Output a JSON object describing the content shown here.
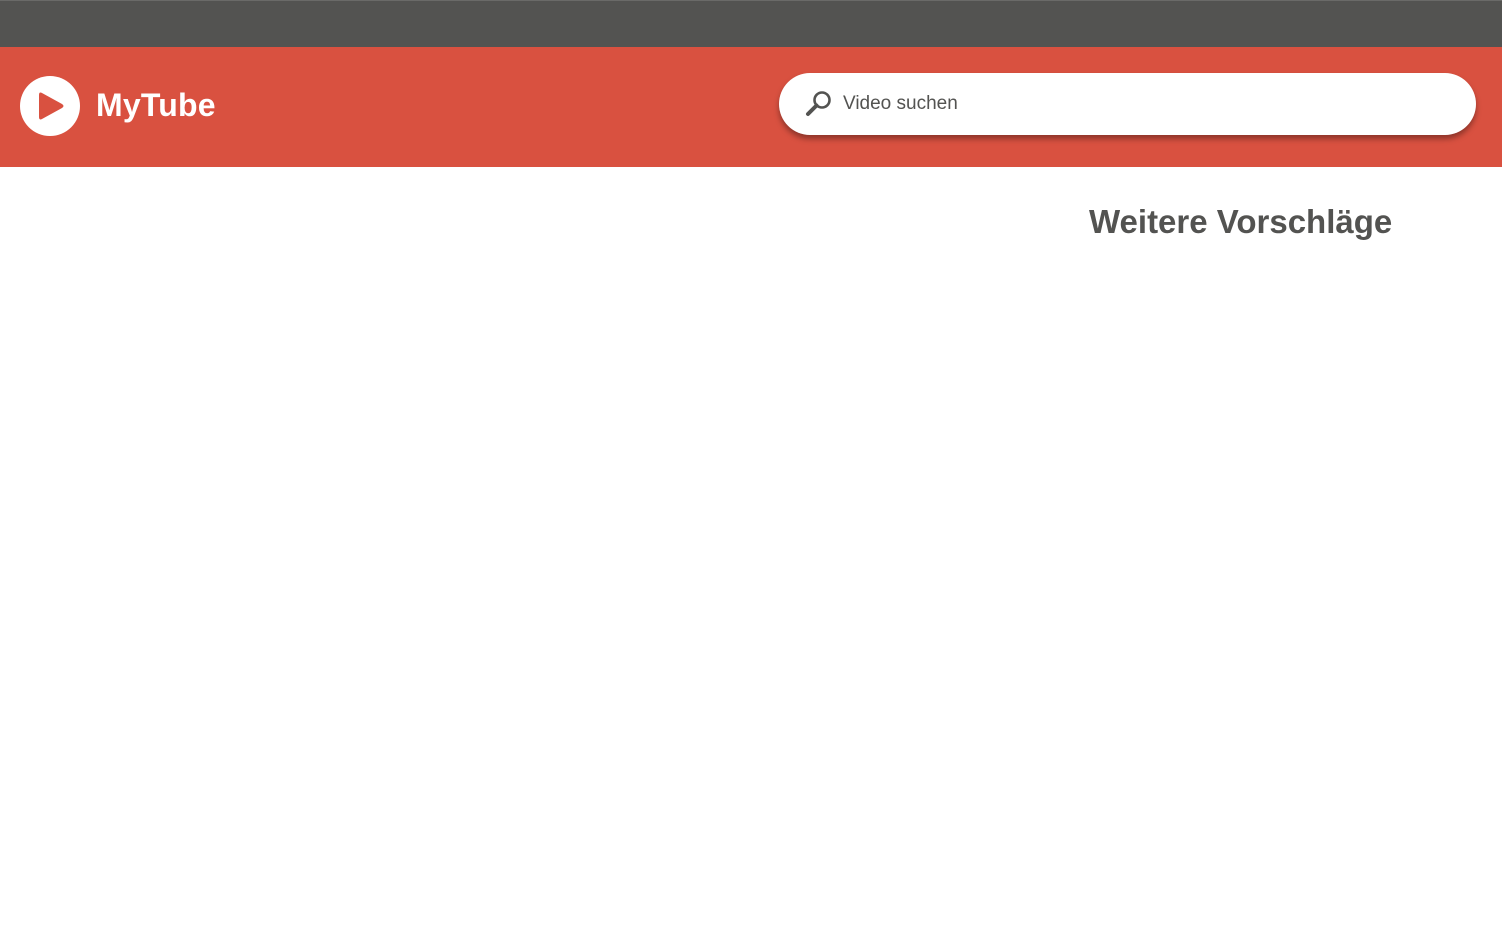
{
  "header": {
    "brand_name": "MyTube",
    "logo_icon": "play-icon",
    "search": {
      "icon": "search-icon",
      "placeholder": "Video suchen",
      "value": ""
    }
  },
  "main": {
    "suggestions_title": "Weitere Vorschläge"
  },
  "colors": {
    "top_bar": "#535351",
    "header": "#d95140",
    "text": "#535351",
    "white": "#ffffff"
  }
}
